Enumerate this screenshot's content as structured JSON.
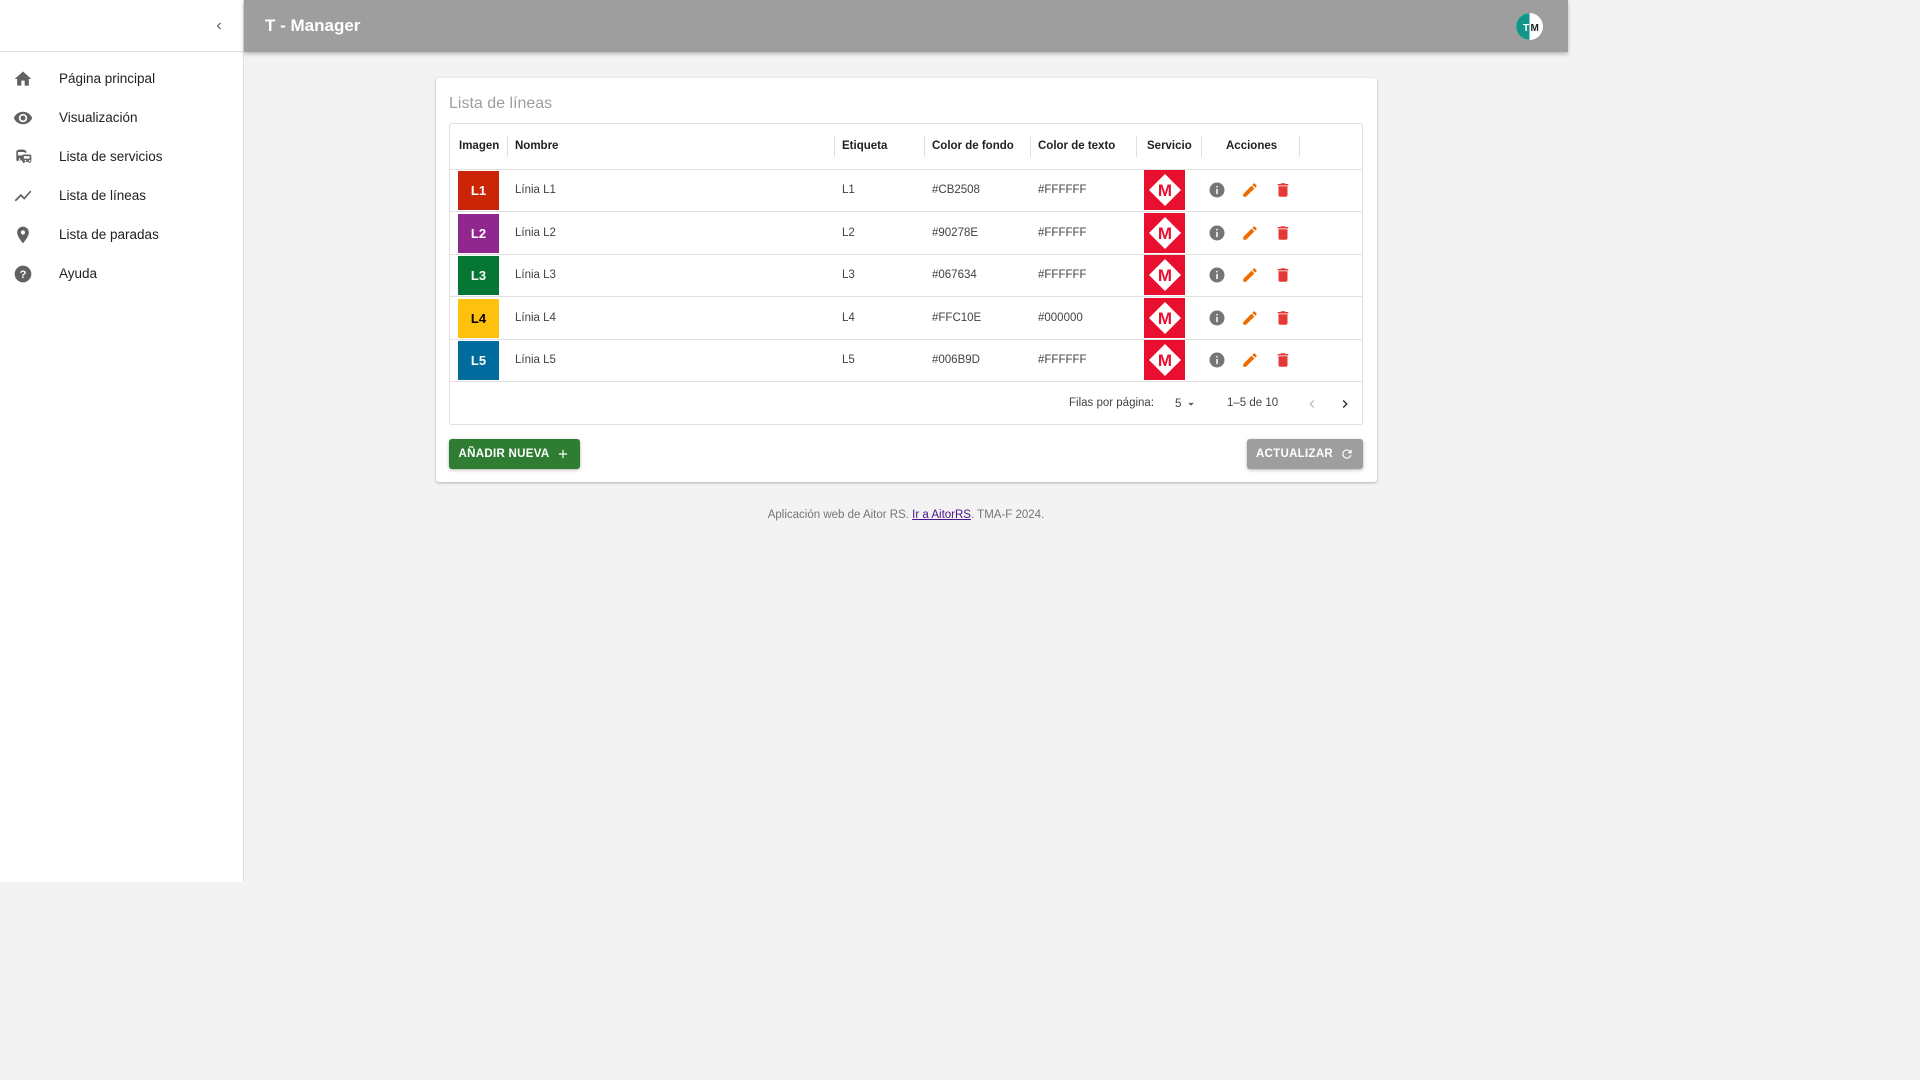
{
  "app": {
    "title": "T - Manager",
    "avatar_text": "TM"
  },
  "sidebar": {
    "items": [
      {
        "label": "Página principal",
        "icon": "home-icon"
      },
      {
        "label": "Visualización",
        "icon": "eye-icon"
      },
      {
        "label": "Lista de servicios",
        "icon": "train-bus-icon"
      },
      {
        "label": "Lista de líneas",
        "icon": "line-chart-icon"
      },
      {
        "label": "Lista de paradas",
        "icon": "map-pin-icon"
      },
      {
        "label": "Ayuda",
        "icon": "help-icon"
      }
    ]
  },
  "card": {
    "title": "Lista de líneas",
    "columns": [
      "Imagen",
      "Nombre",
      "Etiqueta",
      "Color de fondo",
      "Color de texto",
      "Servicio",
      "Acciones"
    ],
    "rows": [
      {
        "badge": "L1",
        "name": "Línia L1",
        "label": "L1",
        "bg": "#CB2508",
        "fg": "#FFFFFF"
      },
      {
        "badge": "L2",
        "name": "Línia L2",
        "label": "L2",
        "bg": "#90278E",
        "fg": "#FFFFFF"
      },
      {
        "badge": "L3",
        "name": "Línia L3",
        "label": "L3",
        "bg": "#067634",
        "fg": "#FFFFFF"
      },
      {
        "badge": "L4",
        "name": "Línia L4",
        "label": "L4",
        "bg": "#FFC10E",
        "fg": "#000000"
      },
      {
        "badge": "L5",
        "name": "Línia L5",
        "label": "L5",
        "bg": "#006B9D",
        "fg": "#FFFFFF"
      }
    ],
    "service_logo_letter": "M",
    "pagination": {
      "rows_label": "Filas por página:",
      "rows_value": "5",
      "range": "1–5 de 10"
    },
    "add_button": "AÑADIR NUEVA",
    "refresh_button": "ACTUALIZAR"
  },
  "footer": {
    "prefix": "Aplicación web de Aitor RS. ",
    "link": "Ir a AitorRS",
    "suffix": ". TMA-F 2024."
  },
  "colors": {
    "header_bg": "#9e9e9e",
    "add_button": "#2e7d32",
    "edit_icon": "#ef6c00",
    "delete_icon": "#e53935",
    "service_logo": "#e8102e"
  }
}
